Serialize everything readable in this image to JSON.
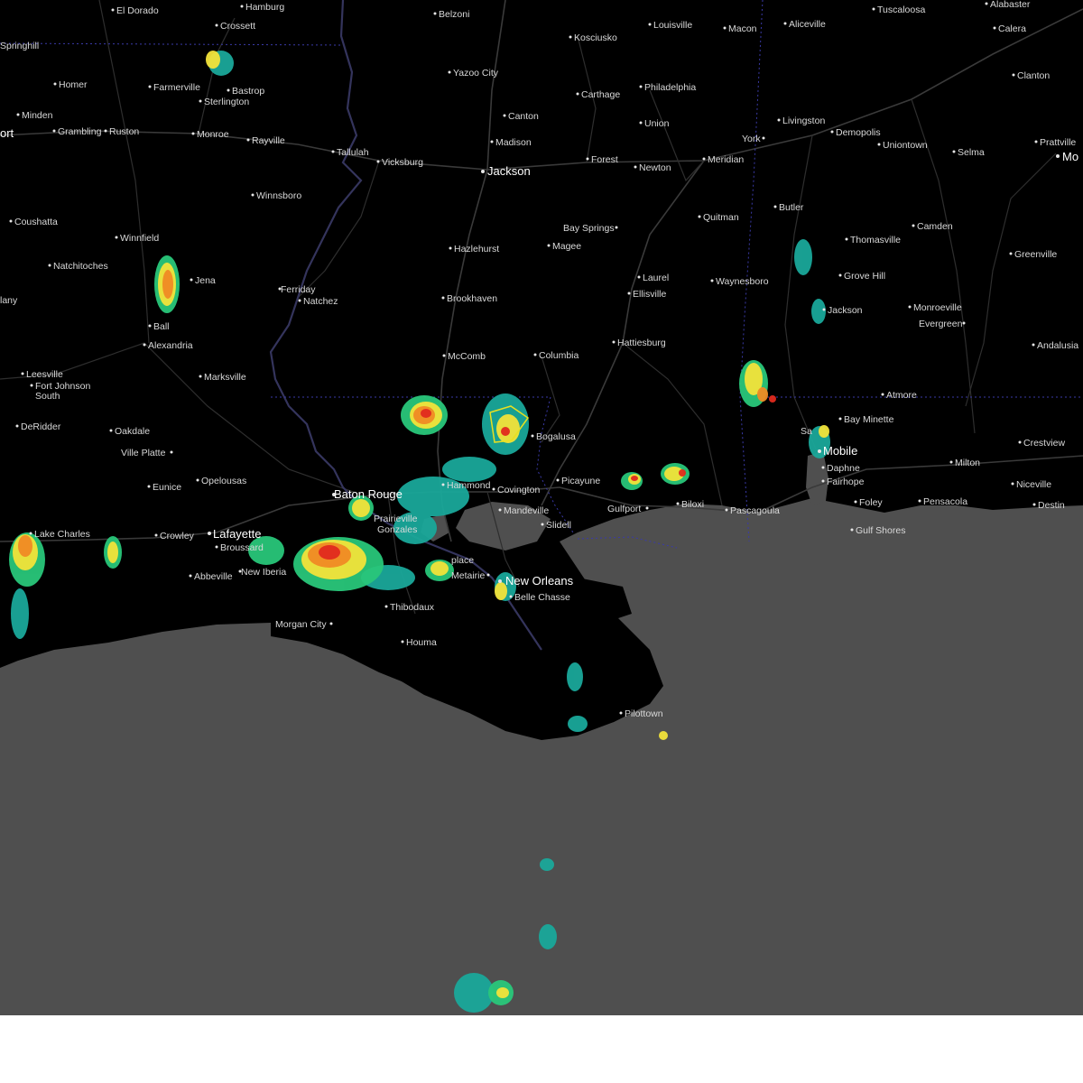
{
  "map": {
    "colors": {
      "land": "#000000",
      "water": "#4f4f4f",
      "page": "#ffffff",
      "radar_light": "#1aa89a",
      "radar_mid": "#29c77a",
      "radar_yellow": "#f2e33a",
      "radar_orange": "#f08a24",
      "radar_red": "#e02a1e",
      "warning_polygon": "#e8e020"
    },
    "cities": {
      "el_dorado": "El Dorado",
      "hamburg": "Hamburg",
      "belzoni": "Belzoni",
      "louisville": "Louisville",
      "macon": "Macon",
      "aliceville": "Aliceville",
      "tuscaloosa": "Tuscaloosa",
      "alabaster": "Alabaster",
      "crossett": "Crossett",
      "calera": "Calera",
      "kosciusko": "Kosciusko",
      "springhill": "Springhill",
      "yazoo_city": "Yazoo City",
      "homer": "Homer",
      "farmerville": "Farmerville",
      "bastrop": "Bastrop",
      "carthage": "Carthage",
      "philadelphia": "Philadelphia",
      "clanton": "Clanton",
      "sterlington": "Sterlington",
      "minden": "Minden",
      "canton": "Canton",
      "livingston": "Livingston",
      "union": "Union",
      "grambling": "Grambling",
      "ruston": "Ruston",
      "monroe": "Monroe",
      "rayville": "Rayville",
      "demopolis": "Demopolis",
      "york": "York",
      "madison": "Madison",
      "uniontown": "Uniontown",
      "prattville": "Prattville",
      "tallulah": "Tallulah",
      "vicksburg": "Vicksburg",
      "jackson": "Jackson",
      "forest": "Forest",
      "newton": "Newton",
      "meridian": "Meridian",
      "selma": "Selma",
      "winnsboro": "Winnsboro",
      "butler": "Butler",
      "coushatta": "Coushatta",
      "quitman": "Quitman",
      "bay_springs": "Bay Springs",
      "camden": "Camden",
      "winnfield": "Winnfield",
      "hazlehurst": "Hazlehurst",
      "magee": "Magee",
      "thomasville": "Thomasville",
      "greenville": "Greenville",
      "natchitoches": "Natchitoches",
      "grove_hill": "Grove Hill",
      "ferriday": "Ferriday",
      "jena": "Jena",
      "laurel": "Laurel",
      "waynesboro": "Waynesboro",
      "natchez": "Natchez",
      "brookhaven": "Brookhaven",
      "ellisville": "Ellisville",
      "monroeville": "Monroeville",
      "jackson_al": "Jackson",
      "many": "lany",
      "ball": "Ball",
      "evergreen": "Evergreen",
      "alexandria": "Alexandria",
      "hattiesburg": "Hattiesburg",
      "andalusia": "Andalusia",
      "mccomb": "McComb",
      "columbia": "Columbia",
      "leesville": "Leesville",
      "marksville": "Marksville",
      "fort_johnson_1": "Fort Johnson",
      "fort_johnson_2": "South",
      "atmore": "Atmore",
      "bay_minette": "Bay Minette",
      "deridder": "DeRidder",
      "oakdale": "Oakdale",
      "bogalusa": "Bogalusa",
      "crestview": "Crestview",
      "ville_platte": "Ville Platte",
      "mobile": "Mobile",
      "saraland": "Sa",
      "milton": "Milton",
      "daphne": "Daphne",
      "picayune": "Picayune",
      "niceville": "Niceville",
      "eunice": "Eunice",
      "opelousas": "Opelousas",
      "hammond": "Hammond",
      "covington": "Covington",
      "fairhope": "Fairhope",
      "baton_rouge": "Baton Rouge",
      "biloxi": "Biloxi",
      "gulfport": "Gulfport",
      "pascagoula": "Pascagoula",
      "foley": "Foley",
      "pensacola": "Pensacola",
      "destin": "Destin",
      "mandeville": "Mandeville",
      "prairieville": "Prairieville",
      "gonzales": "Gonzales",
      "slidell": "Slidell",
      "gulf_shores": "Gulf Shores",
      "lake_charles": "Lake Charles",
      "crowley": "Crowley",
      "lafayette": "Lafayette",
      "broussard": "Broussard",
      "new_iberia": "New Iberia",
      "laplace": "place",
      "metairie": "Metairie",
      "new_orleans": "New Orleans",
      "abbeville": "Abbeville",
      "belle_chasse": "Belle Chasse",
      "thibodaux": "Thibodaux",
      "morgan_city": "Morgan City",
      "houma": "Houma",
      "pilottown": "Pilottown",
      "shreveport": "ort",
      "montgomery": "Mo"
    }
  }
}
